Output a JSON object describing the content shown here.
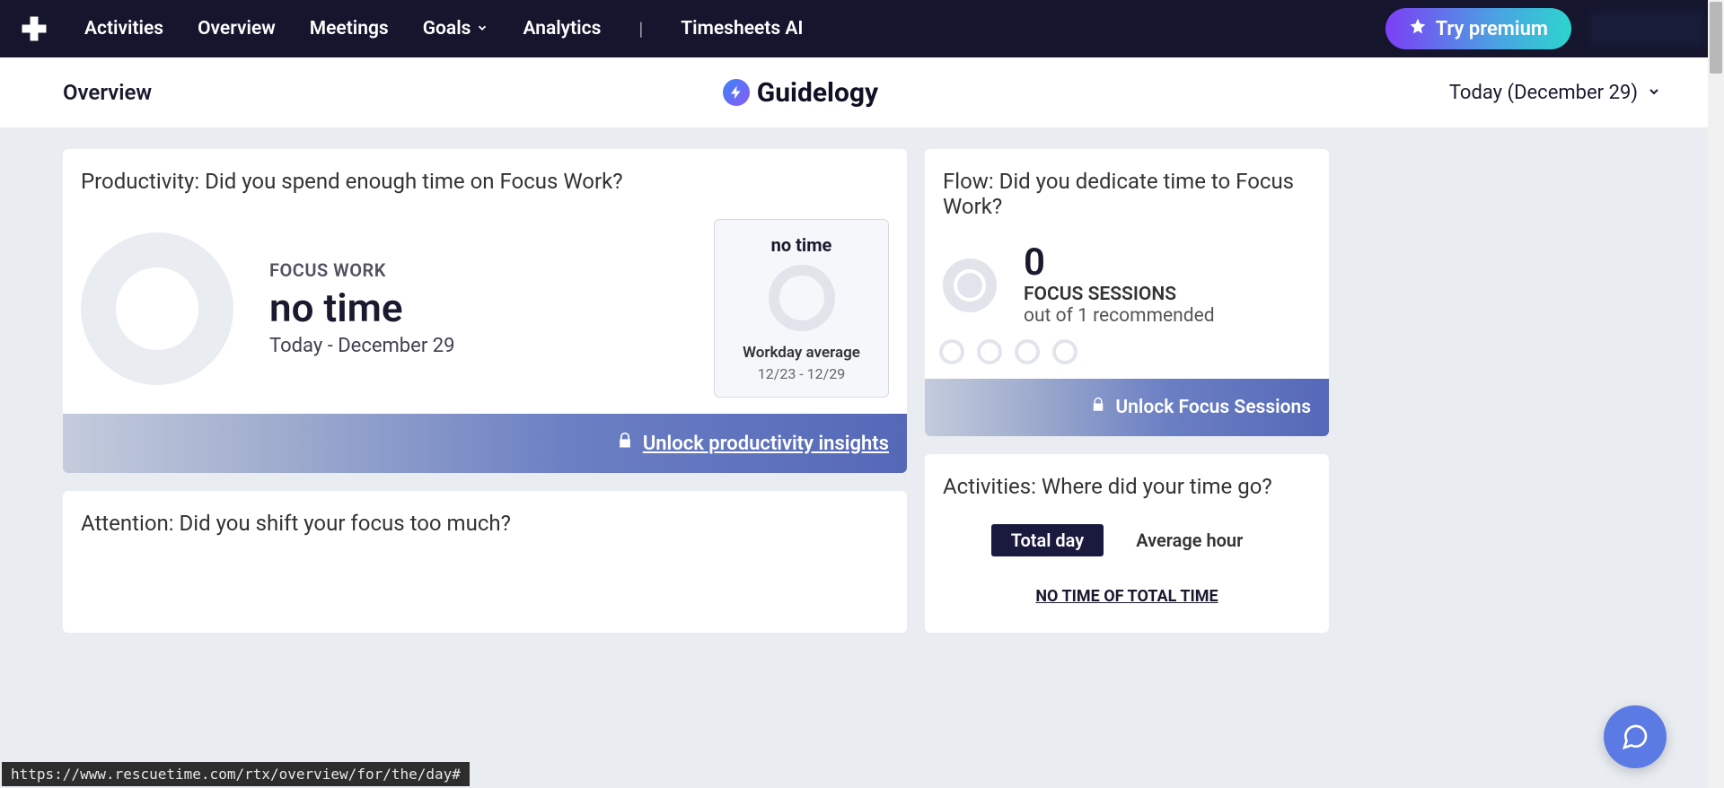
{
  "nav": {
    "activities": "Activities",
    "overview": "Overview",
    "meetings": "Meetings",
    "goals": "Goals",
    "analytics": "Analytics",
    "timesheets": "Timesheets AI",
    "premium": "Try premium"
  },
  "subheader": {
    "title": "Overview",
    "brand": "Guidelogy",
    "date": "Today (December 29)"
  },
  "productivity": {
    "title": "Productivity: Did you spend enough time on Focus Work?",
    "label": "FOCUS WORK",
    "value": "no time",
    "subtitle": "Today - December 29",
    "avg": {
      "value": "no time",
      "label": "Workday average",
      "range": "12/23 - 12/29"
    },
    "unlock": "Unlock productivity insights"
  },
  "attention": {
    "title": "Attention: Did you shift your focus too much?"
  },
  "flow": {
    "title": "Flow: Did you dedicate time to Focus Work?",
    "count": "0",
    "label": "FOCUS SESSIONS",
    "sub": "out of 1 recommended",
    "unlock": "Unlock Focus Sessions"
  },
  "activities": {
    "title": "Activities: Where did your time go?",
    "tab_total": "Total day",
    "tab_avg": "Average hour",
    "msg": "NO TIME OF TOTAL TIME"
  },
  "status_url": "https://www.rescuetime.com/rtx/overview/for/the/day#",
  "chart_data": {
    "type": "pie",
    "title": "Focus Work Today",
    "categories": [
      "Focus Work"
    ],
    "values": [
      0
    ],
    "series": [
      {
        "name": "Today",
        "values": [
          0
        ]
      },
      {
        "name": "Workday average 12/23-12/29",
        "values": [
          0
        ]
      }
    ]
  }
}
